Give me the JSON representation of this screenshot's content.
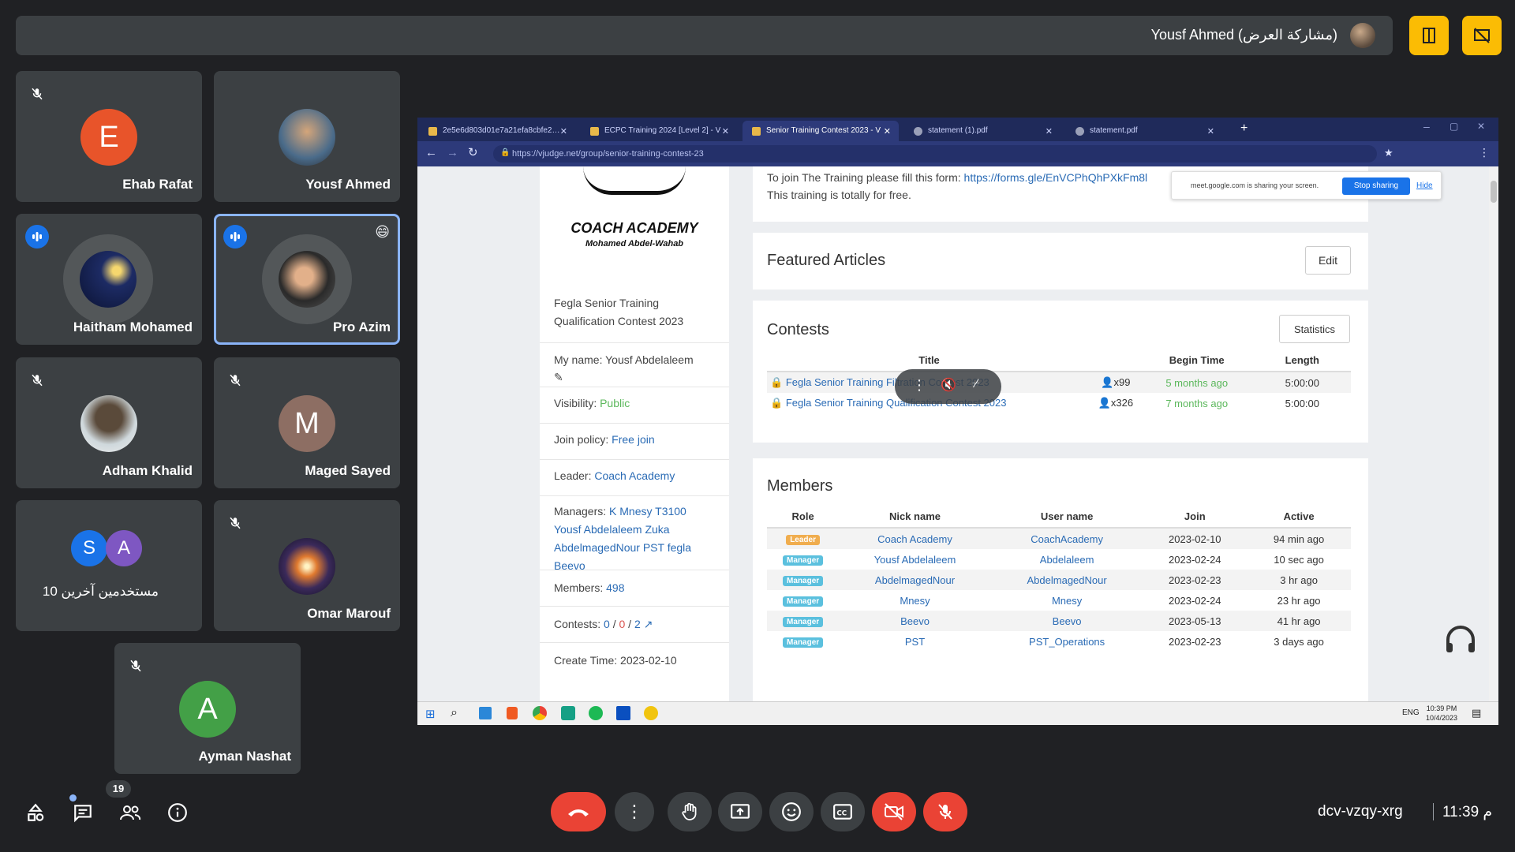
{
  "meeting": {
    "presenter_label": "Yousf Ahmed (مشاركة العرض)",
    "code": "dcv-vzqy-xrg",
    "time": "11:39 م",
    "participant_count": "19"
  },
  "tiles": [
    {
      "name": "Ehab Rafat",
      "initial": "E",
      "color": "#e8542a"
    },
    {
      "name": "Yousf Ahmed"
    },
    {
      "name": "Haitham Mohamed"
    },
    {
      "name": "Pro Azim",
      "emoji": "😄"
    },
    {
      "name": "Adham Khalid"
    },
    {
      "name": "Maged Sayed",
      "initial": "M",
      "color": "#8d6e63"
    },
    {
      "name": "10 مستخدمين آخرين",
      "initial_1": "S",
      "initial_2": "A"
    },
    {
      "name": "Omar Marouf"
    },
    {
      "name": "Ayman Nashat",
      "initial": "A",
      "color": "#43a047"
    }
  ],
  "browser": {
    "tabs": [
      {
        "title": "2e5e6d803d01e7a21efa8cbfe2…"
      },
      {
        "title": "ECPC Training 2024 [Level 2] - V"
      },
      {
        "title": "Senior Training Contest 2023 - V"
      },
      {
        "title": "statement (1).pdf"
      },
      {
        "title": "statement.pdf"
      }
    ],
    "url": "https://vjudge.net/group/senior-training-contest-23",
    "sharing_notice": "meet.google.com is sharing your screen.",
    "stop_sharing": "Stop sharing",
    "hide": "Hide"
  },
  "vjudge": {
    "brand": "COACH ACADEMY",
    "brand_sub": "Mohamed Abdel-Wahab",
    "group_title": "Fegla Senior Training Qualification Contest 2023",
    "my_name": "My name: Yousf Abdelaleem",
    "visibility_label": "Visibility:",
    "visibility_value": "Public",
    "join_label": "Join policy:",
    "join_value": "Free join",
    "leader_label": "Leader:",
    "leader_value": "Coach Academy",
    "managers_label": "Managers:",
    "managers_value": "K Mnesy T3100 Yousf Abdelaleem Zuka AbdelmagedNour PST fegla Beevo",
    "members_label": "Members:",
    "members_value": "498",
    "contests_label": "Contests:",
    "contests_a": "0",
    "contests_b": "0",
    "contests_c": "2",
    "create_time": "Create Time: 2023-02-10",
    "join_text": "To join The Training please fill this form:",
    "join_link": "https://forms.gle/EnVCPhQhPXkFm8l",
    "free_text": "This training is totally for free.",
    "featured_title": "Featured Articles",
    "edit_label": "Edit",
    "contests_title": "Contests",
    "statistics_label": "Statistics",
    "contest_headers": [
      "Title",
      "Begin Time",
      "Length"
    ],
    "contests": [
      {
        "title": "Fegla Senior Training Filtration Contest 2023",
        "count": "x99",
        "begin": "5 months ago",
        "length": "5:00:00"
      },
      {
        "title": "Fegla Senior Training Qualification Contest 2023",
        "count": "x326",
        "begin": "7 months ago",
        "length": "5:00:00"
      }
    ],
    "members_title": "Members",
    "member_headers": [
      "Role",
      "Nick name",
      "User name",
      "Join",
      "Active"
    ],
    "members": [
      {
        "role": "Leader",
        "nick": "Coach Academy",
        "user": "CoachAcademy",
        "join": "2023-02-10",
        "active": "94 min ago"
      },
      {
        "role": "Manager",
        "nick": "Yousf Abdelaleem",
        "user": "Abdelaleem",
        "join": "2023-02-24",
        "active": "10 sec ago"
      },
      {
        "role": "Manager",
        "nick": "AbdelmagedNour",
        "user": "AbdelmagedNour",
        "join": "2023-02-23",
        "active": "3 hr ago"
      },
      {
        "role": "Manager",
        "nick": "Mnesy",
        "user": "Mnesy",
        "join": "2023-02-24",
        "active": "23 hr ago"
      },
      {
        "role": "Manager",
        "nick": "Beevo",
        "user": "Beevo",
        "join": "2023-05-13",
        "active": "41 hr ago"
      },
      {
        "role": "Manager",
        "nick": "PST",
        "user": "PST_Operations",
        "join": "2023-02-23",
        "active": "3 days ago"
      }
    ]
  },
  "taskbar": {
    "lang": "ENG",
    "time": "10:39 PM",
    "date": "10/4/2023"
  },
  "colors": {
    "leader_badge": "#f0ad4e",
    "manager_badge": "#5bc0de",
    "meet_red": "#ea4335",
    "speaking_blue": "#1a73e8",
    "present_yellow": "#fbbc04"
  }
}
